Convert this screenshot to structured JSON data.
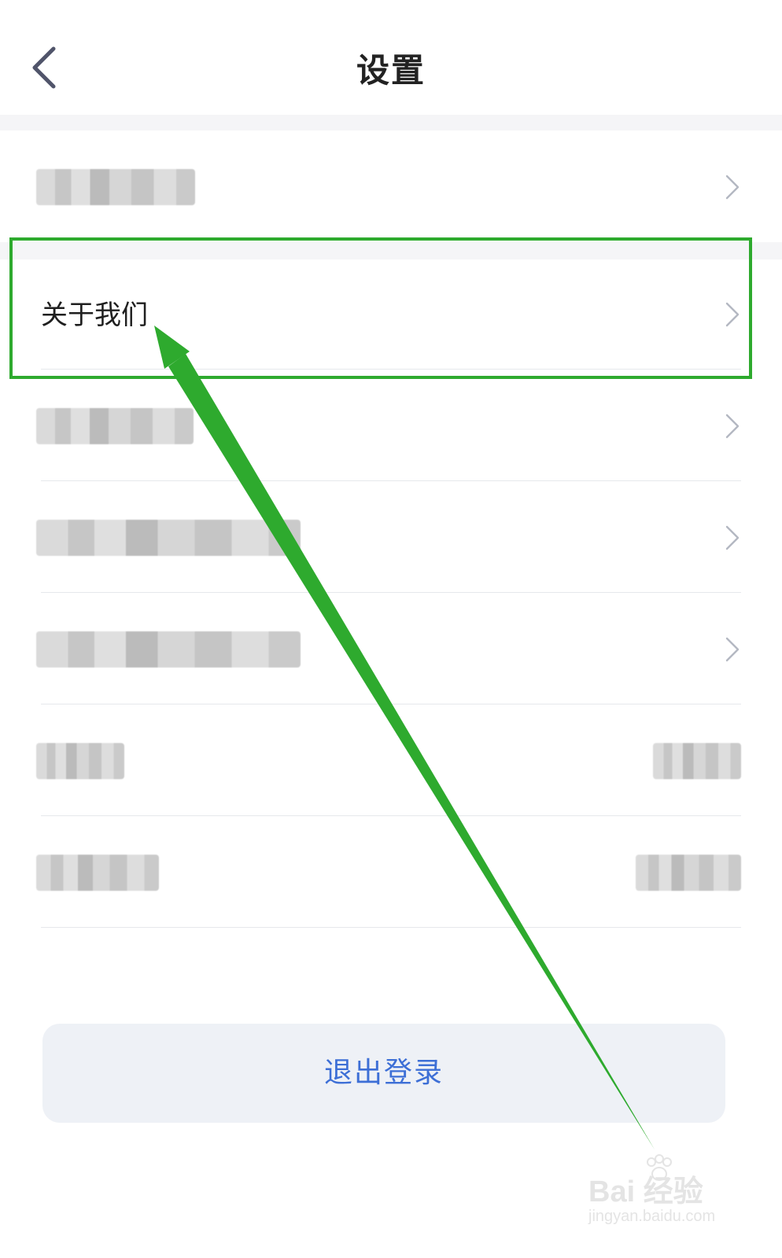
{
  "header": {
    "title": "设置"
  },
  "icons": {
    "back": "chevron-left-icon",
    "row_chevron": "chevron-right-icon",
    "watermark": "baidu-paw-icon"
  },
  "rows": [
    {
      "label": ""
    },
    {
      "label": "关于我们"
    },
    {
      "label": ""
    },
    {
      "label": ""
    },
    {
      "label": ""
    },
    {
      "label": ""
    },
    {
      "label": ""
    }
  ],
  "logout": {
    "label": "退出登录"
  },
  "annotation": {
    "highlight_color": "#2eaa2e",
    "arrow_color": "#2eaa2e"
  },
  "watermark": {
    "brand": "Bai 经验",
    "url": "jingyan.baidu.com"
  },
  "colors": {
    "accent": "#3d6fd6",
    "text": "#1f1f1f",
    "divider": "#e6e8ec"
  }
}
